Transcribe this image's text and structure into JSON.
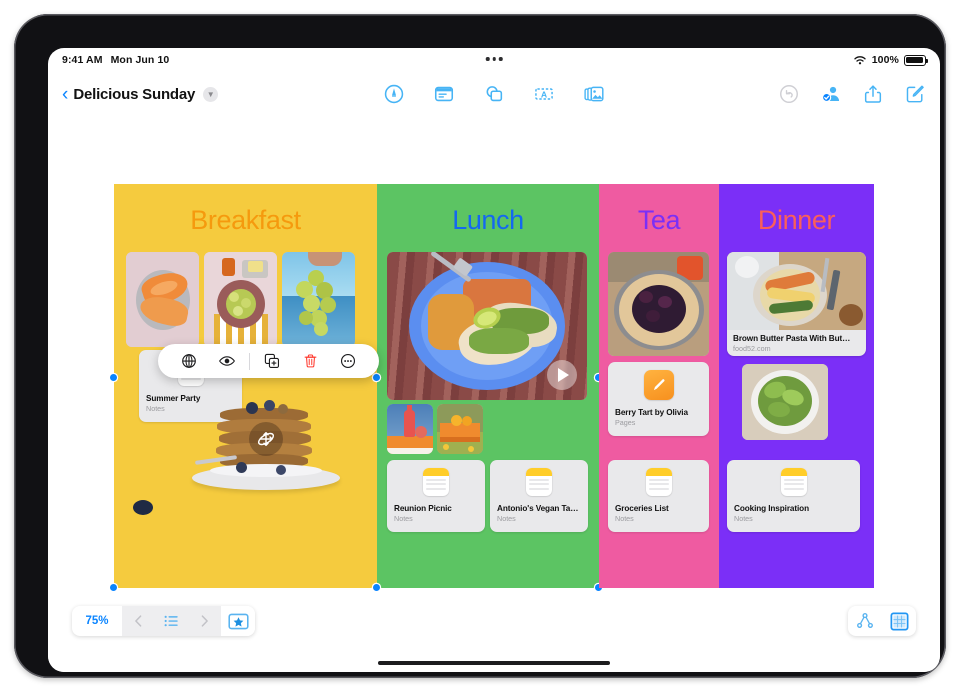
{
  "status_bar": {
    "time": "9:41 AM",
    "date": "Mon Jun 10",
    "wifi_icon": "wifi-icon",
    "battery_percent": "100%",
    "battery_icon": "battery-full-icon",
    "multitask_icon": "multitasking-handle-icon"
  },
  "toolbar": {
    "back_icon": "chevron-left-icon",
    "document_title": "Delicious Sunday",
    "title_menu_icon": "chevron-down-icon",
    "center_tools": [
      {
        "name": "markup-pen-tool",
        "icon": "pen-circle-icon",
        "label": "Markup"
      },
      {
        "name": "sticky-note-tool",
        "icon": "sticky-note-icon",
        "label": "Sticky Note"
      },
      {
        "name": "shapes-tool",
        "icon": "shapes-icon",
        "label": "Shapes"
      },
      {
        "name": "text-box-tool",
        "icon": "text-box-icon",
        "label": "Text Box"
      },
      {
        "name": "media-tool",
        "icon": "photos-icon",
        "label": "Media"
      }
    ],
    "right_tools": [
      {
        "name": "undo-button",
        "icon": "undo-arrow-icon",
        "label": "Undo",
        "enabled": false
      },
      {
        "name": "collaborate-button",
        "icon": "person-badge-checkmark-icon",
        "label": "Collaborate",
        "enabled": true
      },
      {
        "name": "share-button",
        "icon": "share-up-arrow-icon",
        "label": "Share",
        "enabled": true
      },
      {
        "name": "compose-button",
        "icon": "compose-pencil-square-icon",
        "label": "New Board",
        "enabled": true
      }
    ]
  },
  "board": {
    "columns": [
      {
        "name": "breakfast",
        "title": "Breakfast",
        "bg_color": "#f5cb3e",
        "title_color": "#f59a0e",
        "selected": true,
        "photos": [
          {
            "name": "photo-cantaloupe",
            "alt": "Cantaloupe slices on a grey plate"
          },
          {
            "name": "photo-gooseberries",
            "alt": "Gooseberries in a bowl with butter"
          },
          {
            "name": "photo-grapes",
            "alt": "Hand holding green grapes over the sea"
          }
        ],
        "objects": [
          {
            "name": "pancakes-3d-object",
            "alt": "Stack of blueberry pancakes, 3D object",
            "handle_icon": "rotate-3d-icon"
          },
          {
            "name": "blueberry-sticker",
            "alt": "Blueberry"
          }
        ],
        "files": [
          {
            "name": "summer-party-note",
            "title": "Summer Party",
            "subtitle": "Notes",
            "icon": "notes-app-icon",
            "selected": true
          }
        ]
      },
      {
        "name": "lunch",
        "title": "Lunch",
        "bg_color": "#5cc463",
        "title_color": "#1468f0",
        "selected": true,
        "photos": [
          {
            "name": "video-tacos",
            "alt": "Plate of tacos with rice and beans",
            "is_video": true,
            "play_icon": "play-triangle-icon"
          },
          {
            "name": "photo-drinks",
            "alt": "Bottle and drink on orange table"
          },
          {
            "name": "photo-citrus",
            "alt": "Oranges on an orange bench in a field"
          }
        ],
        "files": [
          {
            "name": "reunion-picnic-note",
            "title": "Reunion Picnic",
            "subtitle": "Notes",
            "icon": "notes-app-icon"
          },
          {
            "name": "antonios-vegan-tacos-note",
            "title": "Antonio's Vegan Tacos",
            "subtitle": "Notes",
            "icon": "notes-app-icon"
          }
        ]
      },
      {
        "name": "tea",
        "title": "Tea",
        "bg_color": "#ef5ba1",
        "title_color": "#7b2ff7",
        "photos": [
          {
            "name": "photo-berry-galette",
            "alt": "Berry galette tart on a metal plate"
          }
        ],
        "files": [
          {
            "name": "berry-tart-by-olivia-pages",
            "title": "Berry Tart by Olivia",
            "subtitle": "Pages",
            "icon": "pages-app-icon"
          },
          {
            "name": "groceries-list-note",
            "title": "Groceries List",
            "subtitle": "Notes",
            "icon": "notes-app-icon"
          }
        ]
      },
      {
        "name": "dinner",
        "title": "Dinner",
        "bg_color": "#7b2ff7",
        "title_color": "#fa5f5a",
        "links": [
          {
            "name": "brown-butter-pasta-link",
            "title": "Brown Butter Pasta With But…",
            "subtitle": "food52.com",
            "alt": "Plate of brown butter pasta with cutlery"
          }
        ],
        "photos": [
          {
            "name": "photo-salad",
            "alt": "Green salad in a white bowl"
          }
        ],
        "files": [
          {
            "name": "cooking-inspiration-note",
            "title": "Cooking Inspiration",
            "subtitle": "Notes",
            "icon": "notes-app-icon"
          }
        ]
      }
    ]
  },
  "context_menu": {
    "name": "object-context-menu",
    "items": [
      {
        "name": "replace-icon",
        "icon": "globe-crosshair-icon",
        "label": "Replace"
      },
      {
        "name": "preview-icon",
        "icon": "eye-icon",
        "label": "Preview"
      },
      {
        "name": "duplicate-icon",
        "icon": "duplicate-plus-icon",
        "label": "Duplicate"
      },
      {
        "name": "delete-icon",
        "icon": "trash-icon",
        "label": "Delete",
        "color": "#ff3b30"
      },
      {
        "name": "more-icon",
        "icon": "ellipsis-circle-icon",
        "label": "More"
      }
    ]
  },
  "bottom_bar": {
    "zoom_level": "75%",
    "prev_icon": "chevron-left-icon",
    "list_icon": "bulleted-list-icon",
    "next_icon": "chevron-right-icon",
    "favorite_icon": "star-in-rectangle-icon",
    "right_tools": [
      {
        "name": "connect-objects-button",
        "icon": "node-graph-icon"
      },
      {
        "name": "grid-view-button",
        "icon": "grid-square-icon",
        "active": true
      }
    ]
  },
  "home_indicator": "home-indicator"
}
